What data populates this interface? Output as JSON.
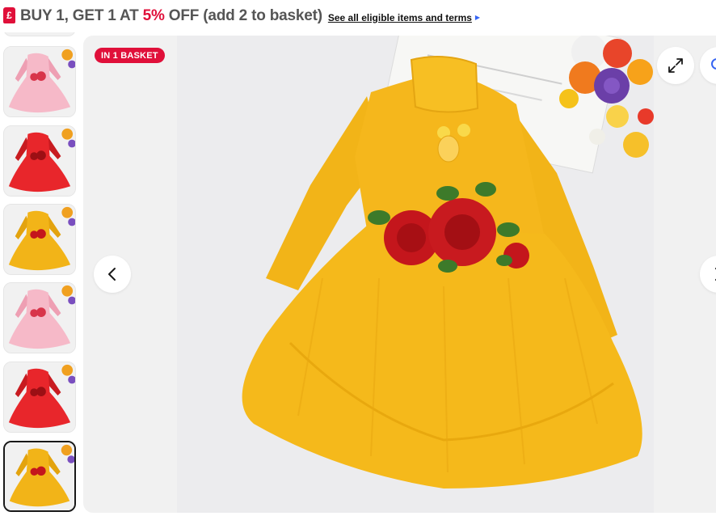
{
  "promo": {
    "icon_glyph": "£",
    "text_before": "BUY 1, GET 1 AT ",
    "text_highlight": "5%",
    "text_after": " OFF (add 2 to basket)",
    "link_label": "See all eligible items and terms",
    "highlight_color": "#e0103a"
  },
  "thumbnails": [
    {
      "color": "pink",
      "selected": false
    },
    {
      "color": "pink",
      "selected": false
    },
    {
      "color": "red",
      "selected": false
    },
    {
      "color": "yellow",
      "selected": false
    },
    {
      "color": "pink",
      "selected": false
    },
    {
      "color": "red",
      "selected": false
    },
    {
      "color": "yellow",
      "selected": true
    }
  ],
  "gallery": {
    "badge_label": "IN 1 BASKET",
    "icons": {
      "prev": "chevron-left-icon",
      "next": "chevron-right-icon",
      "expand": "expand-icon",
      "zoom": "search-icon"
    }
  },
  "colors": {
    "accent": "#e0103a",
    "link_arrow": "#3665f3",
    "dress_yellow": "#f2b418",
    "dress_red": "#e8262b",
    "dress_pink": "#f6b9c8"
  }
}
